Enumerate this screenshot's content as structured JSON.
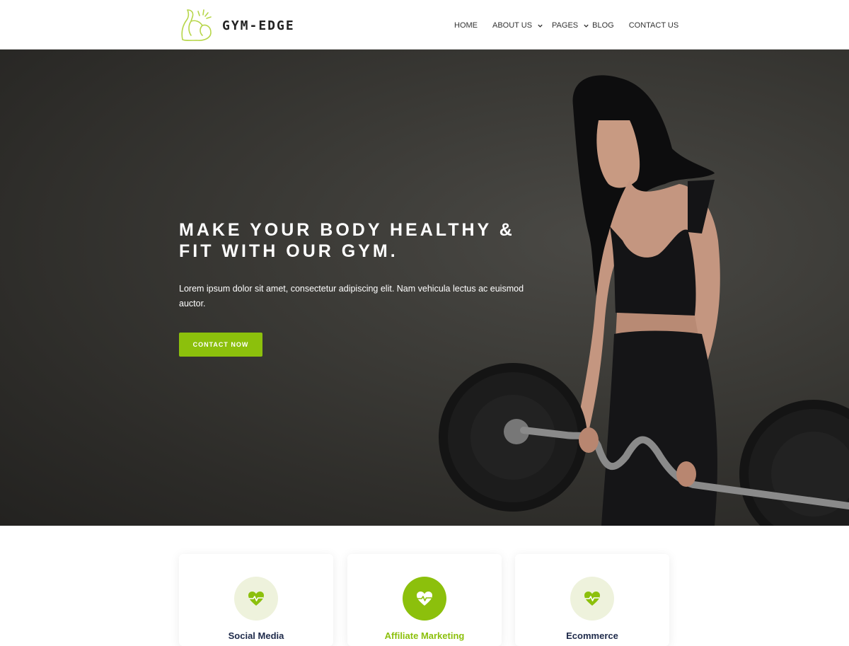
{
  "brand": {
    "name": "GYM-EDGE",
    "accent": "#8cc00c"
  },
  "nav": {
    "home": "HOME",
    "about": "ABOUT US",
    "pages": "PAGES",
    "blog": "BLOG",
    "contact": "CONTACT US"
  },
  "hero": {
    "title": "MAKE YOUR BODY HEALTHY & FIT WITH OUR GYM.",
    "text": "Lorem ipsum dolor sit amet, consectetur adipiscing elit. Nam vehicula lectus ac euismod auctor.",
    "button": "CONTACT NOW"
  },
  "features": [
    {
      "title": "Social Media",
      "icon": "heartbeat-icon",
      "active": false
    },
    {
      "title": "Affiliate Marketing",
      "icon": "heartbeat-icon",
      "active": true
    },
    {
      "title": "Ecommerce",
      "icon": "heartbeat-icon",
      "active": false
    }
  ]
}
